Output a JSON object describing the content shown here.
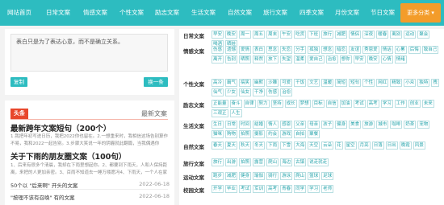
{
  "nav": {
    "items": [
      "网站首页",
      "日常文案",
      "情感文案",
      "个性文案",
      "励志文案",
      "生活文案",
      "自然文案",
      "旅行文案",
      "四季文案",
      "月份文案",
      "节日文案"
    ],
    "more": "更多分类 ▾"
  },
  "quote": {
    "text": "表白只是为了表达心意，而不是确立关系。",
    "copy_label": "复制",
    "next_label": "换一条"
  },
  "hot": {
    "badge": "头条",
    "latest": "最新文案"
  },
  "articles": [
    {
      "title": "最新跨年文案短句（200个）",
      "excerpt": "1.我把年初写进日历，我把2022你也留在。2.一想重来时，我相信这场告别算作不易，我和2022一起告别。3.步骤大笑说一年的阴霾就此翻篇，当我偶遇你时，4.好奇心别停止，你"
    },
    {
      "title": "关于下雨的朋友圈文案（100句）",
      "excerpt": "1、后来有很多个清晨，我却在下雨里想起你。2、都要到下雨天，人和人保持距离，来把的人更加亲密。3、百雨不知道去一睡万缕愿冯4、下雨天，一个人在家里安静"
    }
  ],
  "list": [
    {
      "title": "50个以 \"后来啊\" 开头的文案",
      "date": "2022-06-18"
    },
    {
      "title": "\"按理不该有召唤\" 有的文案",
      "date": "2022-06-18"
    }
  ],
  "categories": [
    {
      "label": "日常文案",
      "tags": [
        "早安",
        "晚安",
        "周一",
        "周五",
        "周末",
        "午安",
        "吃货",
        "下班",
        "旅行",
        "减肥",
        "情侣",
        "深夜",
        "暖春",
        "离别",
        "运动",
        "聚会",
        "喝酒",
        "晒娃"
      ]
    },
    {
      "label": "情感文案",
      "tags": [
        "伤感",
        "遗憾",
        "爱情",
        "表白",
        "思念",
        "失恋",
        "分手",
        "孤独",
        "想念",
        "暗恋",
        "友谊",
        "秀恩爱",
        "情话",
        "心累",
        "后悔",
        "致自己",
        "离开",
        "告别",
        "晒照",
        "释然",
        "放下",
        "失望",
        "温柔",
        "爱自己",
        "治愈",
        "想你",
        "早安",
        "晚安",
        "心情",
        "情绪"
      ]
    },
    {
      "label": "个性文案",
      "tags": [
        "高冷",
        "霸气",
        "搞笑",
        "幽默",
        "沙雕",
        "可爱",
        "干饭",
        "文艺",
        "温暖",
        "简短",
        "短句",
        "个性",
        "网红",
        "精致",
        "小众",
        "独特",
        "拽",
        "仙气",
        "少女",
        "仙女",
        "干净",
        "伤感",
        "治愈"
      ]
    },
    {
      "label": "励志文案",
      "tags": [
        "正能量",
        "奋斗",
        "自律",
        "努力",
        "坚持",
        "成长",
        "梦想",
        "目标",
        "自信",
        "加油",
        "考试",
        "高考",
        "学习",
        "工作",
        "创业",
        "未来",
        "三观正",
        "人生"
      ]
    },
    {
      "label": "生活文案",
      "tags": [
        "生日",
        "日常",
        "时间",
        "结婚",
        "情人",
        "感恩",
        "父亲",
        "母亲",
        "孩子",
        "健身",
        "美食",
        "旅游",
        "城市",
        "咖啡",
        "奶茶",
        "宠物",
        "猫咪",
        "购物",
        "拍照",
        "摄影",
        "约会",
        "游戏",
        "自拍",
        "聚餐"
      ]
    },
    {
      "label": "自然文案",
      "tags": [
        "春天",
        "夏天",
        "秋天",
        "冬天",
        "下雨",
        "下雪",
        "大海",
        "天空",
        "云朵",
        "花",
        "星空",
        "月亮",
        "日落",
        "日出",
        "晚霞",
        "风景"
      ]
    },
    {
      "label": "旅行文案",
      "tags": [
        "旅行",
        "出游",
        "拍照",
        "露营",
        "爬山",
        "海边",
        "古镇",
        "说走就走"
      ]
    },
    {
      "label": "运动文案",
      "tags": [
        "跑步",
        "减肥",
        "健身",
        "瑜伽",
        "骑行",
        "游泳",
        "爬山",
        "篮球",
        "足球"
      ]
    },
    {
      "label": "校园文案",
      "tags": [
        "开学",
        "毕业",
        "考试",
        "军训",
        "高考",
        "青春",
        "同学",
        "学习",
        "老师"
      ]
    }
  ]
}
